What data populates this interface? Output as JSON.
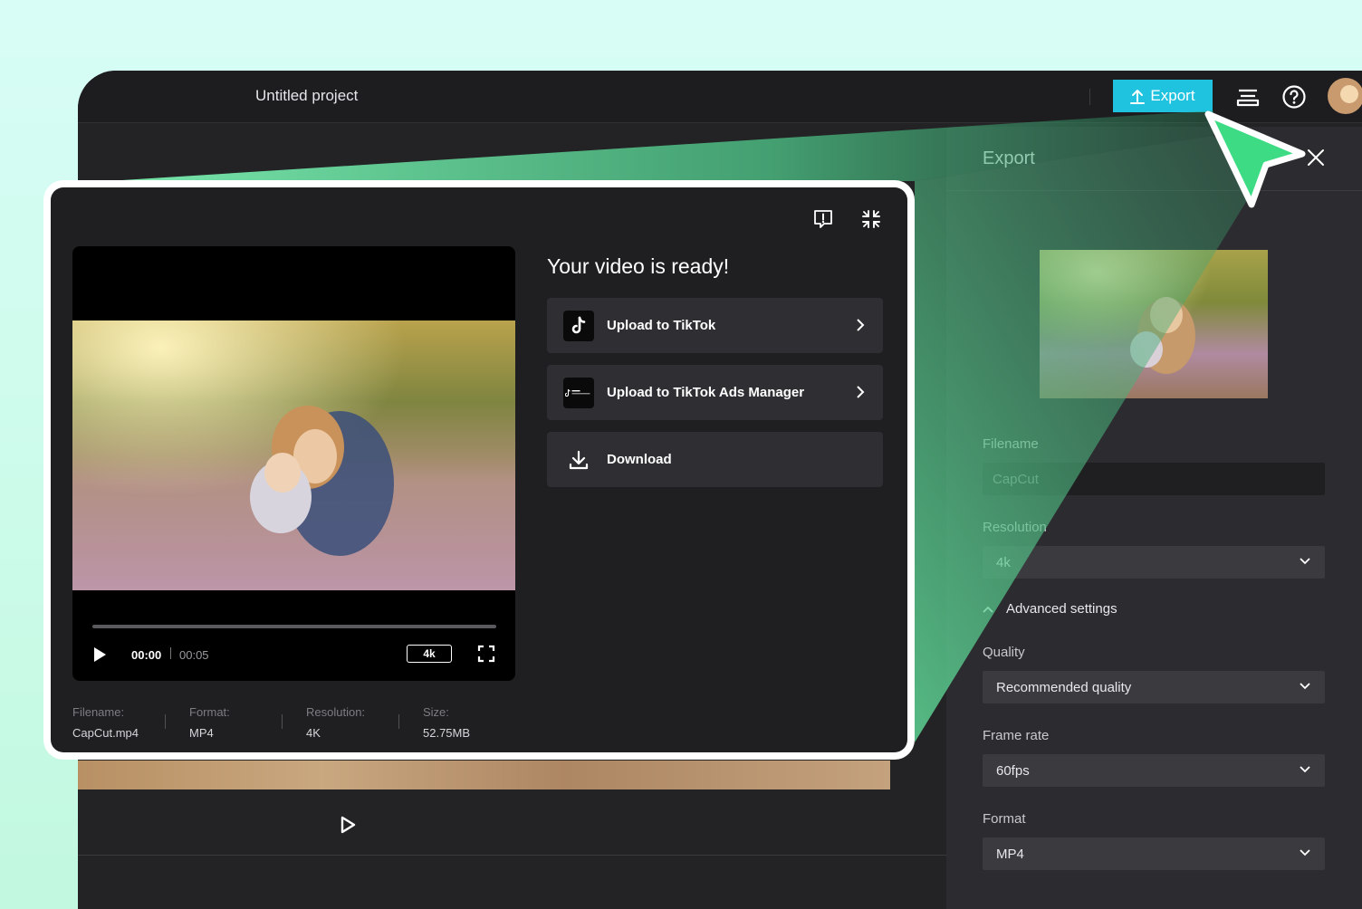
{
  "topbar": {
    "project_title": "Untitled project",
    "export_label": "Export",
    "icons": [
      "upload-icon",
      "layers-icon",
      "help-icon",
      "avatar"
    ]
  },
  "side_panel": {
    "title": "Export",
    "filename_label": "Filename",
    "filename_value": "CapCut",
    "resolution_label": "Resolution",
    "resolution_value": "4k",
    "advanced_label": "Advanced settings",
    "quality_label": "Quality",
    "quality_value": "Recommended quality",
    "framerate_label": "Frame rate",
    "framerate_value": "60fps",
    "format_label": "Format",
    "format_value": "MP4"
  },
  "modal": {
    "heading": "Your video is ready!",
    "actions": [
      {
        "label": "Upload to TikTok",
        "icon": "tiktok-icon"
      },
      {
        "label": "Upload to TikTok Ads Manager",
        "icon": "tiktok-business-icon"
      },
      {
        "label": "Download",
        "icon": "download-icon"
      }
    ],
    "player": {
      "current_time": "00:00",
      "duration": "00:05",
      "resolution_badge": "4k",
      "progress": 0
    },
    "meta": [
      {
        "key": "Filename:",
        "value": "CapCut.mp4"
      },
      {
        "key": "Format:",
        "value": "MP4"
      },
      {
        "key": "Resolution:",
        "value": "4K"
      },
      {
        "key": "Size:",
        "value": "52.75MB"
      }
    ]
  },
  "colors": {
    "accent": "#1fc3e0",
    "cursor": "#3ddc84",
    "panel": "#2c2c30",
    "modal_bg": "#1f1f22"
  }
}
